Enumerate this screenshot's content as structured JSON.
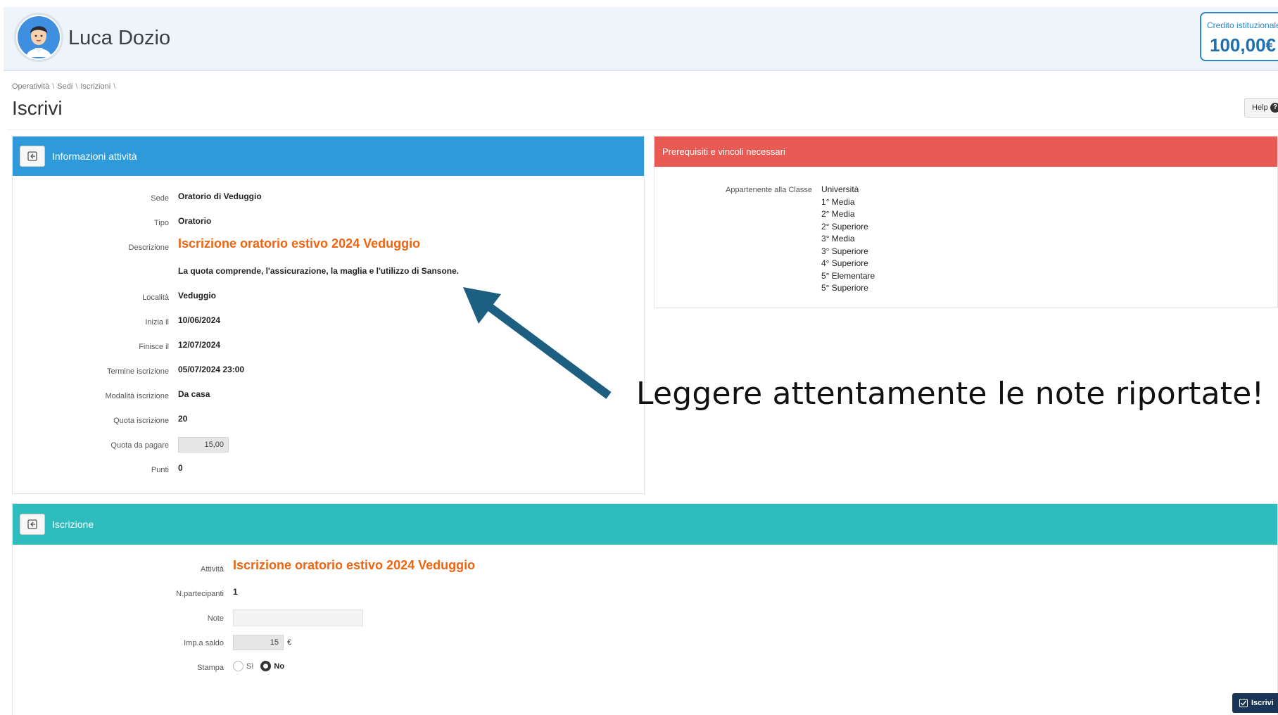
{
  "header": {
    "user_name": "Luca Dozio",
    "credit_label": "Credito istituzionale",
    "credit_value": "100,00€"
  },
  "breadcrumb": [
    "Operatività",
    "Sedi",
    "Iscrizioni"
  ],
  "page_title": "Iscrivi",
  "help_label": "Help",
  "info_panel": {
    "title": "Informazioni attività",
    "fields": {
      "sede_label": "Sede",
      "sede": "Oratorio di Veduggio",
      "tipo_label": "Tipo",
      "tipo": "Oratorio",
      "descrizione_label": "Descrizione",
      "descrizione": "Iscrizione oratorio estivo 2024 Veduggio",
      "nota": "La quota comprende, l'assicurazione, la maglia e l'utilizzo di Sansone.",
      "localita_label": "Località",
      "localita": "Veduggio",
      "inizio_label": "Inizia il",
      "inizio": "10/06/2024",
      "fine_label": "Finisce il",
      "fine": "12/07/2024",
      "termine_label": "Termine iscrizione",
      "termine": "05/07/2024 23:00",
      "modalita_label": "Modalità iscrizione",
      "modalita": "Da casa",
      "quota_label": "Quota iscrizione",
      "quota": "20",
      "quota_pagare_label": "Quota da pagare",
      "quota_pagare": "15,00",
      "punti_label": "Punti",
      "punti": "0"
    }
  },
  "prereq_panel": {
    "title": "Prerequisiti e vincoli necessari",
    "label": "Appartenente alla Classe",
    "classes": [
      "Università",
      "1° Media",
      "2° Media",
      "2° Superiore",
      "3° Media",
      "3° Superiore",
      "4° Superiore",
      "5° Elementare",
      "5° Superiore"
    ]
  },
  "iscrizione_panel": {
    "title": "Iscrizione",
    "attivita_label": "Attività",
    "attivita": "Iscrizione oratorio estivo 2024 Veduggio",
    "partecipanti_label": "N.partecipanti",
    "partecipanti": "1",
    "note_label": "Note",
    "note_value": "",
    "saldo_label": "Imp.a saldo",
    "saldo": "15",
    "saldo_currency": "€",
    "stampa_label": "Stampa",
    "stampa_options": [
      "Sì",
      "No"
    ],
    "stampa_selected": "No"
  },
  "annotation": {
    "text": "Leggere attentamente le note riportate!",
    "arrow_color": "#1c5f80"
  },
  "submit_label": "Iscrivi",
  "colors": {
    "info_header": "#2e9ad9",
    "prereq_header": "#ea5a55",
    "iscrizione_header": "#2ebcbd",
    "highlight_text": "#f06410",
    "submit_button": "#1b3556"
  }
}
